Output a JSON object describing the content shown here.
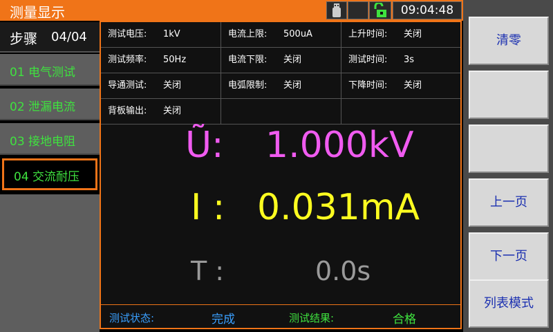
{
  "title": "测量显示",
  "status": {
    "usb_icon": "usb-icon",
    "lock_icon": "unlock-icon",
    "time": "09:04:48"
  },
  "steps": {
    "header_label": "步骤",
    "header_count": "04/04",
    "items": [
      {
        "label": "01  电气测试"
      },
      {
        "label": "02  泄漏电流"
      },
      {
        "label": "03  接地电阻"
      },
      {
        "label": "04  交流耐压"
      }
    ]
  },
  "params": [
    [
      {
        "k": "测试电压:",
        "v": "1kV"
      },
      {
        "k": "电流上限:",
        "v": "500uA"
      },
      {
        "k": "上升时间:",
        "v": "关闭"
      }
    ],
    [
      {
        "k": "测试频率:",
        "v": "50Hz"
      },
      {
        "k": "电流下限:",
        "v": "关闭"
      },
      {
        "k": "测试时间:",
        "v": "3s"
      }
    ],
    [
      {
        "k": "导通测试:",
        "v": "关闭"
      },
      {
        "k": "电弧限制:",
        "v": "关闭"
      },
      {
        "k": "下降时间:",
        "v": "关闭"
      }
    ],
    [
      {
        "k": "背板输出:",
        "v": "关闭"
      },
      {
        "k": "",
        "v": ""
      },
      {
        "k": "",
        "v": ""
      }
    ]
  ],
  "readout": {
    "u_label": "Ũ:",
    "u_value": "1.000kV",
    "i_label": "I :",
    "i_value": "0.031mA",
    "t_label": "T :",
    "t_value": "0.0s"
  },
  "statusbar": {
    "state_label": "测试状态:",
    "state_value": "完成",
    "result_label": "测试结果:",
    "result_value": "合格"
  },
  "softkeys": [
    "清零",
    "",
    "",
    "上一页",
    "下一页",
    "列表模式"
  ],
  "colors": {
    "accent": "#f07418",
    "voltage": "#f05bf0",
    "current": "#ffff20",
    "time": "#9a9a9a",
    "step_text": "#3fe23f",
    "state_text": "#3aa0ff",
    "softkey_text": "#1a2fb0"
  }
}
